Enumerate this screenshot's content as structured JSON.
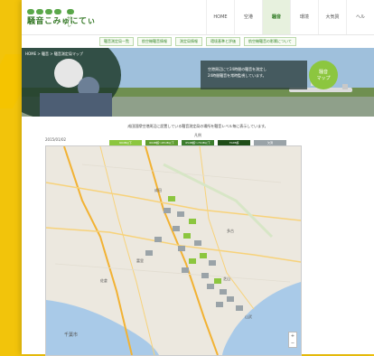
{
  "site": {
    "logo_sub": "たがし",
    "logo_name": "騒音こみゅにてぃ"
  },
  "nav": [
    "HOME",
    "空港",
    "騒音",
    "環境",
    "大気質",
    "ヘル"
  ],
  "subnav": [
    "騒音測定局一覧",
    "航空機騒音情報",
    "測定局情報",
    "環境基準と評価",
    "航空機騒音の影響について"
  ],
  "hero": {
    "breadcrumb": "HOME > 騒音 > 騒音測定局マップ",
    "card_line1": "空港周辺にて24時間の騒音を測定し",
    "card_line2": "24時間騒音を常時監視しています。",
    "badge_line1": "騒音",
    "badge_line2": "マップ"
  },
  "lead": "成田国際空港周辺に設置している騒音測定局の場所を騒音レベル毎に表示しています。",
  "legend": {
    "title": "凡例",
    "items": [
      {
        "label": "60dB以下",
        "color": "#8cc63f"
      },
      {
        "label": "60dB超〜65dB以下",
        "color": "#5f9c2f"
      },
      {
        "label": "65dB超〜70dB以下",
        "color": "#3c7d2e"
      },
      {
        "label": "70dB超",
        "color": "#1f4d18"
      },
      {
        "label": "欠測",
        "color": "#9aa3a8"
      }
    ]
  },
  "map": {
    "date": "2015/01/02",
    "places": [
      "成田",
      "富里",
      "芝山",
      "多古",
      "山武",
      "千葉市",
      "佐倉"
    ]
  }
}
